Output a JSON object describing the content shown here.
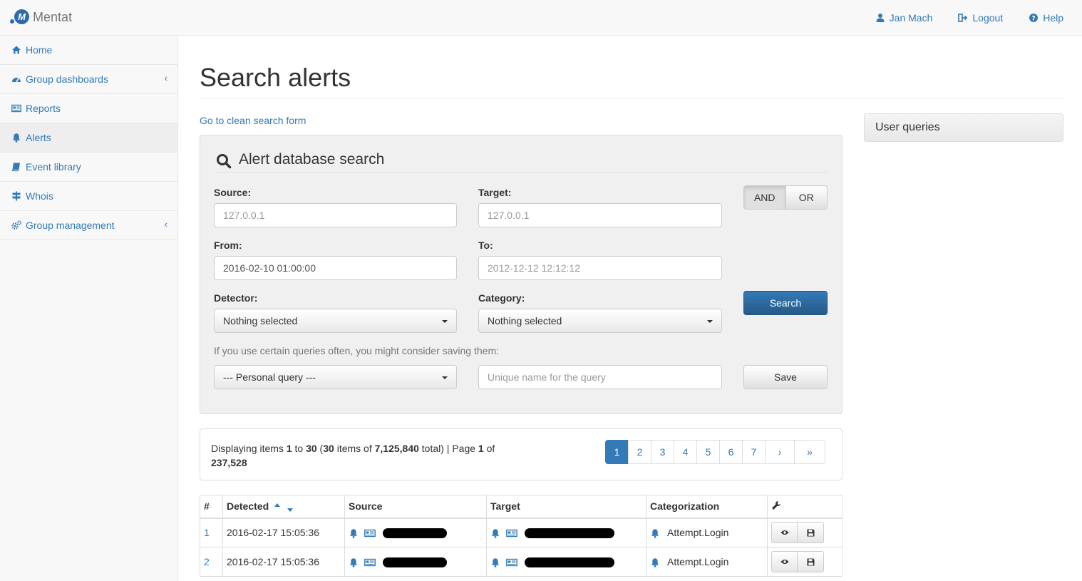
{
  "app": {
    "brand": "Mentat",
    "logo_letter": "M"
  },
  "navbar": {
    "user": {
      "label": "Jan Mach",
      "icon": "user-icon"
    },
    "logout": {
      "label": "Logout",
      "icon": "sign-out-icon"
    },
    "help": {
      "label": "Help",
      "icon": "question-circle-icon"
    }
  },
  "sidebar": {
    "items": [
      {
        "label": "Home",
        "icon": "home-icon",
        "active": false,
        "submenu": false
      },
      {
        "label": "Group dashboards",
        "icon": "dashboard-icon",
        "active": false,
        "submenu": true
      },
      {
        "label": "Reports",
        "icon": "newspaper-icon",
        "active": false,
        "submenu": false
      },
      {
        "label": "Alerts",
        "icon": "bell-icon",
        "active": true,
        "submenu": false
      },
      {
        "label": "Event library",
        "icon": "book-icon",
        "active": false,
        "submenu": false
      },
      {
        "label": "Whois",
        "icon": "signpost-icon",
        "active": false,
        "submenu": false
      },
      {
        "label": "Group management",
        "icon": "cogs-icon",
        "active": false,
        "submenu": true
      }
    ]
  },
  "page": {
    "title": "Search alerts",
    "clean_link": "Go to clean search form"
  },
  "search": {
    "heading": "Alert database search",
    "source_label": "Source:",
    "source_placeholder": "127.0.0.1",
    "target_label": "Target:",
    "target_placeholder": "127.0.0.1",
    "from_label": "From:",
    "from_value": "2016-02-10 01:00:00",
    "to_label": "To:",
    "to_placeholder": "2012-12-12 12:12:12",
    "detector_label": "Detector:",
    "detector_value": "Nothing selected",
    "category_label": "Category:",
    "category_value": "Nothing selected",
    "logic_and": "AND",
    "logic_or": "OR",
    "logic_selected": "AND",
    "search_button": "Search",
    "hint": "If you use certain queries often, you might consider saving them:",
    "personal_query": "--- Personal query ---",
    "query_name_placeholder": "Unique name for the query",
    "save_button": "Save"
  },
  "user_queries": {
    "title": "User queries"
  },
  "pager": {
    "text_displaying": "Displaying items ",
    "from": "1",
    "text_to": " to ",
    "to": "30",
    "text_open": " (",
    "count": "30",
    "text_items_of": " items of ",
    "total": "7,125,840",
    "text_total": " total) | Page ",
    "page": "1",
    "text_of": " of",
    "pages": "237,528",
    "links": [
      "1",
      "2",
      "3",
      "4",
      "5",
      "6",
      "7",
      "›",
      "»"
    ],
    "current": "1"
  },
  "table": {
    "columns": [
      "#",
      "Detected",
      "Source",
      "Target",
      "Categorization"
    ],
    "tools_icon": "wrench-icon",
    "rows": [
      {
        "num": "1",
        "detected": "2016-02-17 15:05:36",
        "category": "Attempt.Login"
      },
      {
        "num": "2",
        "detected": "2016-02-17 15:05:36",
        "category": "Attempt.Login"
      }
    ]
  },
  "colors": {
    "link": "#337ab7",
    "primary": "#265a88",
    "well": "#f0f0f0",
    "sidebar": "#f8f8f8",
    "redaction": "#000000"
  }
}
